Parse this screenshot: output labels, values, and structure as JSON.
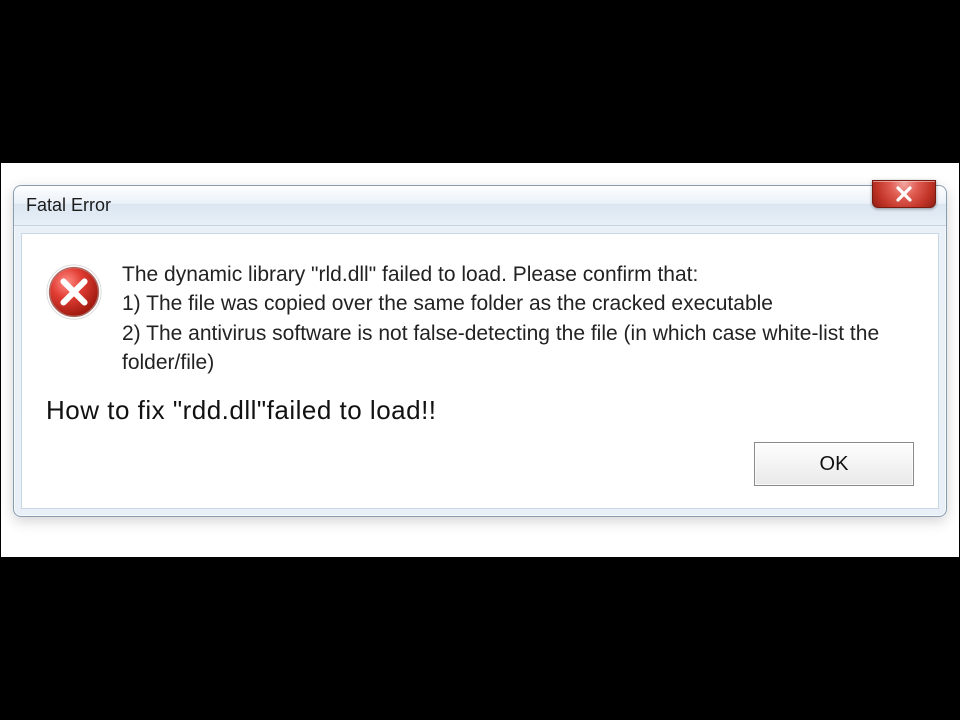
{
  "dialog": {
    "title": "Fatal Error",
    "message": {
      "line1": "The dynamic library \"rld.dll\" failed to load. Please confirm that:",
      "line2": "1) The file was copied over the same folder as the cracked executable",
      "line3": "2) The antivirus software is not false-detecting the file (in which case white-list the folder/file)"
    },
    "caption": "How to fix \"rdd.dll\"failed to load!!",
    "ok_label": "OK"
  }
}
